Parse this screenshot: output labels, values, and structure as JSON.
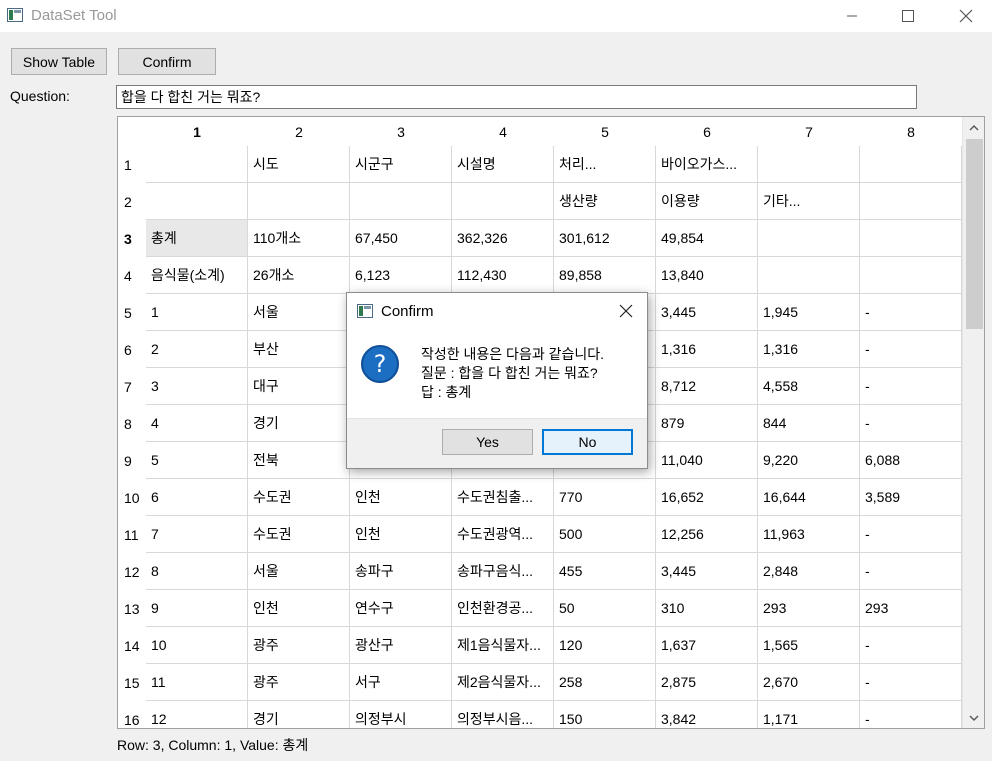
{
  "window": {
    "title": "DataSet Tool"
  },
  "toolbar": {
    "show_table_label": "Show Table",
    "confirm_label": "Confirm"
  },
  "question": {
    "label": "Question:",
    "value": "합을 다 합친 거는 뭐죠?"
  },
  "table": {
    "column_headers": [
      "1",
      "2",
      "3",
      "4",
      "5",
      "6",
      "7",
      "8"
    ],
    "rows": [
      {
        "header": "1",
        "cells": [
          "",
          "시도",
          "시군구",
          "시설명",
          "처리...",
          "바이오가스...",
          "",
          ""
        ]
      },
      {
        "header": "2",
        "cells": [
          "",
          "",
          "",
          "",
          "생산량",
          "이용량",
          "기타...",
          ""
        ]
      },
      {
        "header": "3",
        "cells": [
          "총계",
          "110개소",
          "67,450",
          "362,326",
          "301,612",
          "49,854",
          "",
          ""
        ]
      },
      {
        "header": "4",
        "cells": [
          "음식물(소계)",
          "26개소",
          "6,123",
          "112,430",
          "89,858",
          "13,840",
          "",
          ""
        ]
      },
      {
        "header": "5",
        "cells": [
          "1",
          "서울",
          "",
          "",
          "",
          "3,445",
          "1,945",
          "-"
        ]
      },
      {
        "header": "6",
        "cells": [
          "2",
          "부산",
          "",
          "",
          "",
          "1,316",
          "1,316",
          "-"
        ]
      },
      {
        "header": "7",
        "cells": [
          "3",
          "대구",
          "",
          "",
          "",
          "8,712",
          "4,558",
          "-"
        ]
      },
      {
        "header": "8",
        "cells": [
          "4",
          "경기",
          "",
          "",
          "",
          "879",
          "844",
          "-"
        ]
      },
      {
        "header": "9",
        "cells": [
          "5",
          "전북",
          "",
          "",
          "",
          "11,040",
          "9,220",
          "6,088"
        ]
      },
      {
        "header": "10",
        "cells": [
          "6",
          "수도권",
          "인천",
          "수도권침출...",
          "770",
          "16,652",
          "16,644",
          "3,589"
        ]
      },
      {
        "header": "11",
        "cells": [
          "7",
          "수도권",
          "인천",
          "수도권광역...",
          "500",
          "12,256",
          "11,963",
          "-"
        ]
      },
      {
        "header": "12",
        "cells": [
          "8",
          "서울",
          "송파구",
          "송파구음식...",
          "455",
          "3,445",
          "2,848",
          "-"
        ]
      },
      {
        "header": "13",
        "cells": [
          "9",
          "인천",
          "연수구",
          "인천환경공...",
          "50",
          "310",
          "293",
          "293"
        ]
      },
      {
        "header": "14",
        "cells": [
          "10",
          "광주",
          "광산구",
          "제1음식물자...",
          "120",
          "1,637",
          "1,565",
          "-"
        ]
      },
      {
        "header": "15",
        "cells": [
          "11",
          "광주",
          "서구",
          "제2음식물자...",
          "258",
          "2,875",
          "2,670",
          "-"
        ]
      },
      {
        "header": "16",
        "cells": [
          "12",
          "경기",
          "의정부시",
          "의정부시음...",
          "150",
          "3,842",
          "1,171",
          "-"
        ]
      }
    ]
  },
  "status": "Row: 3, Column: 1, Value: 총계",
  "dialog": {
    "title": "Confirm",
    "icon": "question-icon",
    "message_lines": [
      "작성한 내용은 다음과 같습니다.",
      "질문 : 합을 다 합친 거는 뭐죠?",
      "답 : 총계"
    ],
    "yes_label": "Yes",
    "no_label": "No"
  },
  "colors": {
    "accent": "#0078d7",
    "question_icon": "#1b6ec2"
  }
}
